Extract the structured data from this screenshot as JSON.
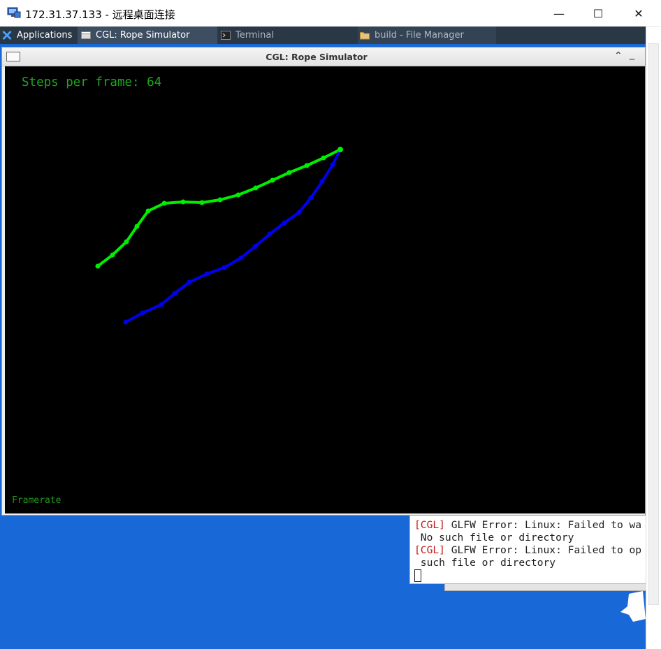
{
  "rdp_window": {
    "title": "172.31.37.133 - 远程桌面连接",
    "minimize_glyph": "—",
    "maximize_glyph": "☐",
    "close_glyph": "✕"
  },
  "panel": {
    "applications_label": "Applications",
    "tasks": [
      {
        "label": "CGL: Rope Simulator",
        "icon": "window-icon",
        "active": true
      },
      {
        "label": "Terminal",
        "icon": "terminal-icon",
        "active": false
      },
      {
        "label": "build - File Manager",
        "icon": "folder-icon",
        "active": false
      }
    ]
  },
  "app_window": {
    "title": "CGL: Rope Simulator",
    "shade_glyph": "⌃",
    "minimize_glyph": "_"
  },
  "simulation": {
    "steps_label": "Steps per frame: 64",
    "framerate_label": "Framerate",
    "green_color": "#00ee00",
    "blue_color": "#0000ee"
  },
  "terminal": {
    "lines": [
      {
        "prefix": "[CGL]",
        "text": " GLFW Error: Linux: Failed to wa"
      },
      {
        "prefix": "",
        "text": " No such file or directory"
      },
      {
        "prefix": "[CGL]",
        "text": " GLFW Error: Linux: Failed to op"
      },
      {
        "prefix": "",
        "text": " such file or directory"
      }
    ]
  }
}
